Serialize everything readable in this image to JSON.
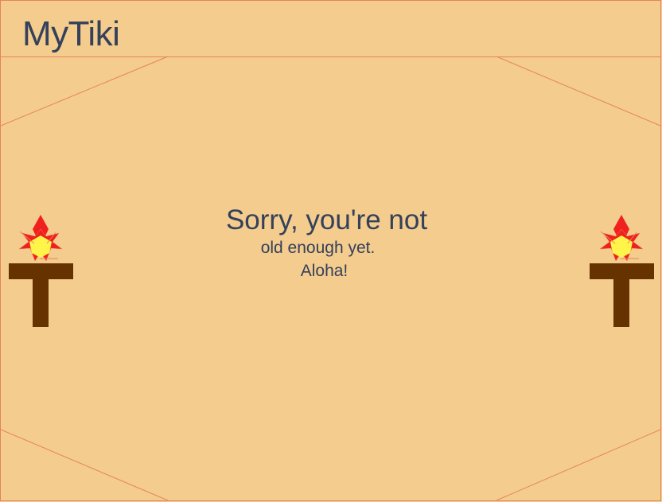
{
  "header": {
    "title": "MyTiki"
  },
  "message": {
    "line1": "Sorry, you're not",
    "line2": "old enough yet.",
    "line3": "Aloha!"
  },
  "icons": {
    "left_torch": "tiki-torch-icon",
    "right_torch": "tiki-torch-icon"
  },
  "colors": {
    "background": "#f3cc8e",
    "border": "#e8845a",
    "text": "#35405a",
    "torch_post": "#663300",
    "flame_outer": "#f0201e",
    "flame_inner": "#fff44a"
  }
}
